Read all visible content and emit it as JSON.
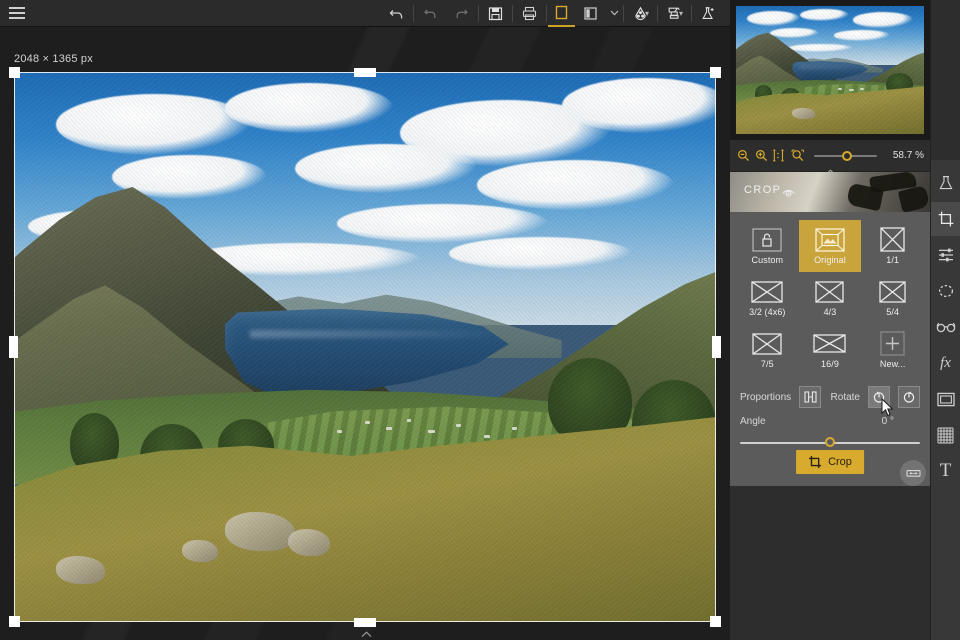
{
  "app": {
    "title": "Photo Editor",
    "accent": "#d8ab2e",
    "panel_bg": "#5b5b5b",
    "toolbar_bg": "#2b2b2b"
  },
  "toolbar": {
    "menu_label": "Menu",
    "buttons": [
      {
        "name": "undo",
        "icon": "undo-icon",
        "label": "Undo",
        "state": "enabled"
      },
      {
        "name": "step-back",
        "icon": "step-back-icon",
        "label": "Step Back",
        "state": "disabled"
      },
      {
        "name": "redo",
        "icon": "redo-icon",
        "label": "Redo",
        "state": "disabled"
      },
      {
        "name": "save",
        "icon": "save-icon",
        "label": "Save"
      },
      {
        "name": "print",
        "icon": "print-icon",
        "label": "Print"
      },
      {
        "name": "single-view",
        "icon": "single-view-icon",
        "label": "Single View",
        "state": "active"
      },
      {
        "name": "split-view",
        "icon": "split-view-icon",
        "label": "Split View"
      },
      {
        "name": "view-options",
        "icon": "chevron-down-icon",
        "label": "View Options"
      },
      {
        "name": "color-picker",
        "icon": "droplet-icon",
        "label": "Color"
      },
      {
        "name": "presets",
        "icon": "presets-icon",
        "label": "Presets"
      },
      {
        "name": "effects-lab",
        "icon": "flask-plus-icon",
        "label": "Effects Lab"
      }
    ]
  },
  "canvas": {
    "image_dimensions": "2048 × 1365 px",
    "crop_handles": [
      "top-left",
      "top-center",
      "top-right",
      "middle-left",
      "middle-right",
      "bottom-left",
      "bottom-center",
      "bottom-right"
    ]
  },
  "preview": {
    "name": "navigator-preview",
    "alt": "Ullswater lake valley landscape"
  },
  "zoombar": {
    "icons": [
      {
        "name": "zoom-out-icon",
        "label": "Zoom Out"
      },
      {
        "name": "zoom-in-icon",
        "label": "Zoom In"
      },
      {
        "name": "zoom-actual-icon",
        "label": "1:1"
      },
      {
        "name": "zoom-fit-icon",
        "label": "Fit to Screen"
      }
    ],
    "zoom_value": "58.7 %",
    "slider_position_pct": 44
  },
  "crop_panel": {
    "header_title": "CROP",
    "header_eye_icon": "eye-icon",
    "ratios": [
      {
        "label": "Custom",
        "icon": "lock-icon",
        "selected": false
      },
      {
        "label": "Original",
        "icon": "original-icon",
        "selected": true
      },
      {
        "label": "1/1",
        "icon": "ratio-icon",
        "selected": false
      },
      {
        "label": "3/2 (4x6)",
        "icon": "ratio-icon",
        "selected": false
      },
      {
        "label": "4/3",
        "icon": "ratio-icon",
        "selected": false
      },
      {
        "label": "5/4",
        "icon": "ratio-icon",
        "selected": false
      },
      {
        "label": "7/5",
        "icon": "ratio-icon",
        "selected": false
      },
      {
        "label": "16/9",
        "icon": "ratio-icon",
        "selected": false
      },
      {
        "label": "New...",
        "icon": "plus-icon",
        "selected": false
      }
    ],
    "proportions_label": "Proportions",
    "proportions_icon": "flip-orientation-icon",
    "rotate_label": "Rotate",
    "rotate_left_icon": "rotate-left-icon",
    "rotate_right_icon": "rotate-right-icon",
    "angle_label": "Angle",
    "angle_value": "0 °",
    "angle_slider_pct": 50,
    "angle_reset_icon": "level-reset-icon",
    "crop_button_label": "Crop",
    "crop_button_icon": "crop-icon"
  },
  "rail": {
    "items": [
      {
        "label": "Effects",
        "icon": "flask-icon",
        "selected": false
      },
      {
        "label": "Crop",
        "icon": "crop-icon",
        "selected": true
      },
      {
        "label": "Adjust",
        "icon": "sliders-icon",
        "selected": false
      },
      {
        "label": "Selection",
        "icon": "selection-icon",
        "selected": false
      },
      {
        "label": "Retouch",
        "icon": "glasses-icon",
        "selected": false
      },
      {
        "label": "Effects FX",
        "icon": "fx-icon",
        "selected": false
      },
      {
        "label": "Frame",
        "icon": "frame-icon",
        "selected": false
      },
      {
        "label": "Texture",
        "icon": "grid-icon",
        "selected": false
      },
      {
        "label": "Text",
        "icon": "text-icon",
        "selected": false
      }
    ]
  },
  "statusbar": {
    "expand_icon": "chevron-up-icon"
  }
}
